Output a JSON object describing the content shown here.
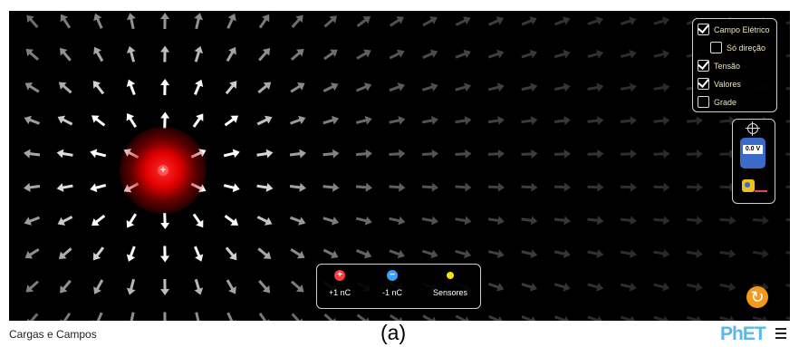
{
  "sim": {
    "title": "Cargas e Campos",
    "charge_symbol": "+"
  },
  "controls": {
    "electric_field": {
      "label": "Campo Elétrico",
      "checked": true
    },
    "direction_only": {
      "label": "Só direção",
      "checked": false
    },
    "voltage": {
      "label": "Tensão",
      "checked": true
    },
    "values": {
      "label": "Valores",
      "checked": true
    },
    "grid": {
      "label": "Grade",
      "checked": false
    }
  },
  "tools": {
    "voltmeter_reading": "0.0 V"
  },
  "toolbox": {
    "positive": {
      "label": "+1 nC",
      "symbol": "+"
    },
    "negative": {
      "label": "-1 nC",
      "symbol": "−"
    },
    "sensors": {
      "label": "Sensores"
    }
  },
  "caption": "(a)",
  "logo": {
    "main": "PhET",
    "menu_icon": "hamburger-icon"
  },
  "colors": {
    "background": "#000000",
    "positive": "#ff3b3b",
    "negative": "#3aa0ff",
    "sensor": "#f5e400",
    "reset": "#f39a1c",
    "label": "#f0e6b0"
  }
}
